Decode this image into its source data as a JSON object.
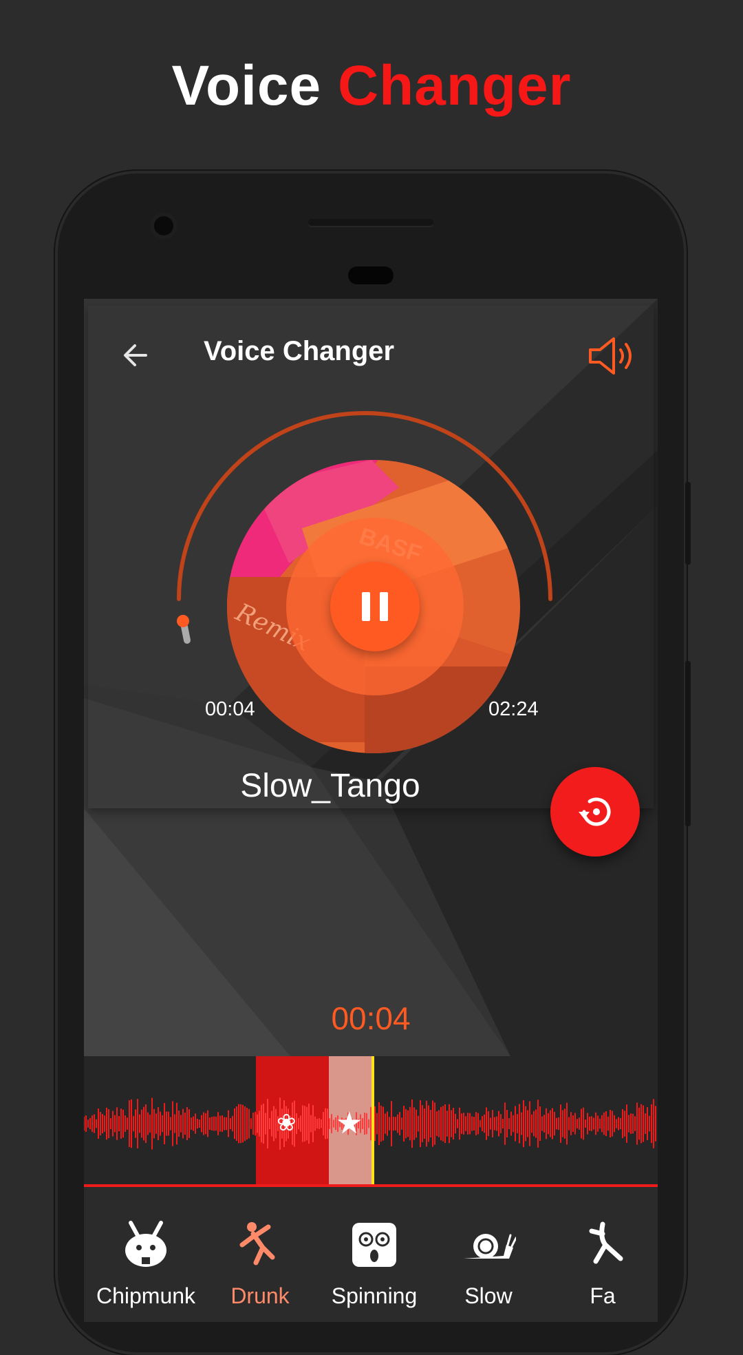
{
  "headline": {
    "word1": "Voice",
    "word2": "Changer"
  },
  "appbar": {
    "title": "Voice Changer",
    "back_icon": "arrow-left-icon",
    "volume_icon": "speaker-icon"
  },
  "player": {
    "current_time": "00:04",
    "total_time": "02:24",
    "track_name": "Slow_Tango",
    "state": "playing",
    "progress": 0.03
  },
  "timeline": {
    "position_time": "00:04"
  },
  "effects": [
    {
      "label": "Chipmunk",
      "icon": "chipmunk-icon",
      "selected": false
    },
    {
      "label": "Drunk",
      "icon": "drunk-person-icon",
      "selected": true
    },
    {
      "label": "Spinning",
      "icon": "spinning-face-icon",
      "selected": false
    },
    {
      "label": "Slow",
      "icon": "snail-icon",
      "selected": false
    },
    {
      "label": "Fa",
      "icon": "person-icon",
      "selected": false
    }
  ],
  "colors": {
    "accent": "#ff5a22",
    "brand_red": "#f31c1c",
    "wave_red": "#ee1b1b",
    "background": "#2c2c2c"
  }
}
